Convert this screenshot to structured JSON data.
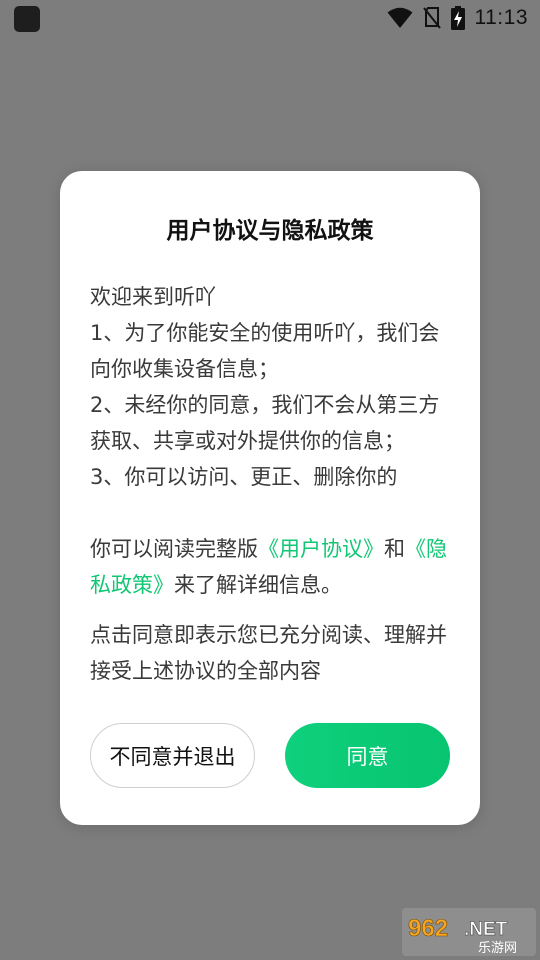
{
  "status_bar": {
    "time": "11:13",
    "icons": [
      "wifi-icon",
      "no-sim-icon",
      "battery-charging-icon"
    ]
  },
  "dialog": {
    "title": "用户协议与隐私政策",
    "body_lines": [
      "欢迎来到听吖",
      "1、为了你能安全的使用听吖，我们会向你收集设备信息；",
      "2、未经你的同意，我们不会从第三方获取、共享或对外提供你的信息；",
      "3、你可以访问、更正、删除你的"
    ],
    "read_prefix": "你可以阅读完整版",
    "user_agreement_link": "《用户协议》",
    "and_text": "和",
    "privacy_policy_link": "《隐私政策》",
    "read_suffix": "来了解详细信息。",
    "confirm_text": "点击同意即表示您已充分阅读、理解并接受上述协议的全部内容",
    "disagree_button": "不同意并退出",
    "agree_button": "同意"
  },
  "watermark": {
    "brand": "962.NET",
    "sub": "乐游网"
  },
  "colors": {
    "accent_green": "#12c774",
    "overlay_gray": "#7d7d7d"
  }
}
